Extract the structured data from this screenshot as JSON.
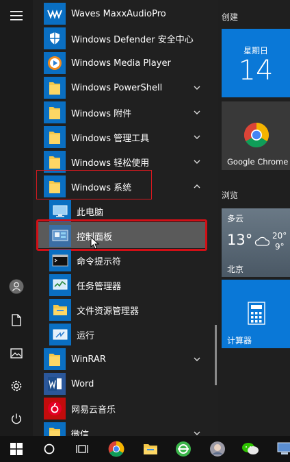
{
  "apps": [
    {
      "id": "waves",
      "label": "Waves MaxxAudioPro",
      "icon": "waves-icon"
    },
    {
      "id": "defender",
      "label": "Windows Defender 安全中心",
      "icon": "shield-icon"
    },
    {
      "id": "mediaplayer",
      "label": "Windows Media Player",
      "icon": "media-player-icon"
    },
    {
      "id": "powershell",
      "label": "Windows PowerShell",
      "icon": "folder-icon"
    },
    {
      "id": "accessories",
      "label": "Windows 附件",
      "icon": "folder-icon"
    },
    {
      "id": "admintools",
      "label": "Windows 管理工具",
      "icon": "folder-icon"
    },
    {
      "id": "easeofaccess",
      "label": "Windows 轻松使用",
      "icon": "folder-icon"
    },
    {
      "id": "system",
      "label": "Windows 系统",
      "icon": "folder-icon"
    },
    {
      "id": "thispc",
      "label": "此电脑",
      "icon": "computer-icon"
    },
    {
      "id": "controlpanel",
      "label": "控制面板",
      "icon": "control-panel-icon"
    },
    {
      "id": "cmd",
      "label": "命令提示符",
      "icon": "cmd-icon"
    },
    {
      "id": "taskmgr",
      "label": "任务管理器",
      "icon": "task-manager-icon"
    },
    {
      "id": "explorer",
      "label": "文件资源管理器",
      "icon": "file-explorer-icon"
    },
    {
      "id": "run",
      "label": "运行",
      "icon": "run-icon"
    },
    {
      "id": "winrar",
      "label": "WinRAR",
      "icon": "folder-icon"
    },
    {
      "id": "word",
      "label": "Word",
      "icon": "word-icon"
    },
    {
      "id": "netease",
      "label": "网易云音乐",
      "icon": "netease-music-icon"
    },
    {
      "id": "wechat",
      "label": "微信",
      "icon": "folder-icon"
    }
  ],
  "tiles": {
    "create_title": "创建",
    "browse_title": "浏览",
    "calendar": {
      "weekday": "星期日",
      "day": "14"
    },
    "chrome": {
      "label": "Google Chrome"
    },
    "weather": {
      "condition": "多云",
      "temp": "13°",
      "high": "20°",
      "low": "9°",
      "city": "北京"
    },
    "calculator": {
      "label": "计算器"
    }
  },
  "colors": {
    "tile_blue": "#0a78d7",
    "highlight_red": "#d20f16",
    "selected": "#5a5a5a"
  }
}
